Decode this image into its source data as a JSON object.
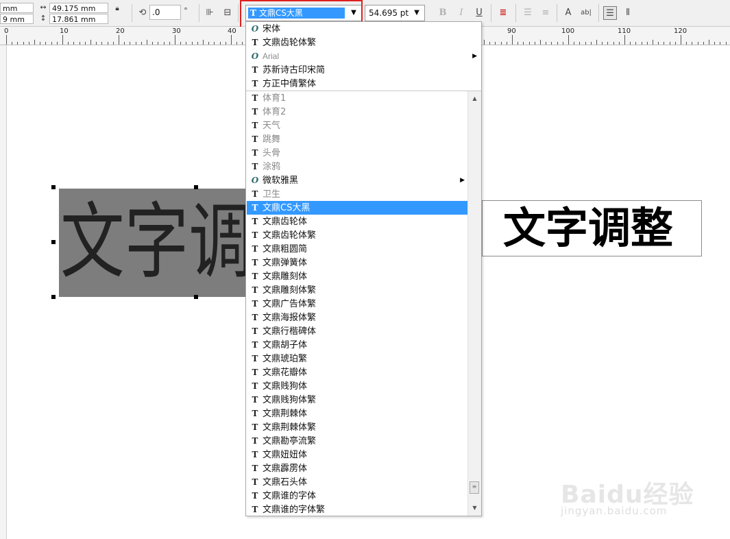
{
  "toolbar": {
    "x_unit": "mm",
    "y_unit": "9 mm",
    "width_value": "49.175 mm",
    "height_value": "17.861 mm",
    "rotation_value": ".0",
    "rotation_unit": "°",
    "font_name": "文鼎CS大黑",
    "font_size": "54.695 pt",
    "bold_label": "B",
    "italic_label": "I",
    "underline_label": "U"
  },
  "ruler": {
    "labels": [
      "0",
      "10",
      "20",
      "30",
      "40",
      "90",
      "100",
      "110",
      "120"
    ]
  },
  "canvas": {
    "gray_text": "文字调",
    "bold_text": "文字调整"
  },
  "dropdown": {
    "recent_fonts": [
      {
        "label": "宋体",
        "type": "opentype"
      },
      {
        "label": "文鼎齿轮体繁",
        "type": "truetype"
      },
      {
        "label": "Arial",
        "type": "opentype"
      },
      {
        "label": "苏新诗古印宋简",
        "type": "truetype"
      },
      {
        "label": "方正中倩繁体",
        "type": "truetype"
      }
    ],
    "fonts": [
      {
        "label": "体育1",
        "type": "truetype"
      },
      {
        "label": "体育2",
        "type": "truetype"
      },
      {
        "label": "天气",
        "type": "truetype"
      },
      {
        "label": "跳舞",
        "type": "truetype"
      },
      {
        "label": "头骨",
        "type": "truetype"
      },
      {
        "label": "涂鸦",
        "type": "truetype"
      },
      {
        "label": "微软雅黑",
        "type": "opentype"
      },
      {
        "label": "卫生",
        "type": "truetype"
      },
      {
        "label": "文鼎CS大黑",
        "type": "truetype"
      },
      {
        "label": "文鼎齿轮体",
        "type": "truetype"
      },
      {
        "label": "文鼎齿轮体繁",
        "type": "truetype"
      },
      {
        "label": "文鼎粗圆简",
        "type": "truetype"
      },
      {
        "label": "文鼎弹簧体",
        "type": "truetype"
      },
      {
        "label": "文鼎雕刻体",
        "type": "truetype"
      },
      {
        "label": "文鼎雕刻体繁",
        "type": "truetype"
      },
      {
        "label": "文鼎广告体繁",
        "type": "truetype"
      },
      {
        "label": "文鼎海报体繁",
        "type": "truetype"
      },
      {
        "label": "文鼎行楷碑体",
        "type": "truetype"
      },
      {
        "label": "文鼎胡子体",
        "type": "truetype"
      },
      {
        "label": "文鼎琥珀繁",
        "type": "truetype"
      },
      {
        "label": "文鼎花瓣体",
        "type": "truetype"
      },
      {
        "label": "文鼎贱狗体",
        "type": "truetype"
      },
      {
        "label": "文鼎贱狗体繁",
        "type": "truetype"
      },
      {
        "label": "文鼎荆棘体",
        "type": "truetype"
      },
      {
        "label": "文鼎荆棘体繁",
        "type": "truetype"
      },
      {
        "label": "文鼎勘亭流繁",
        "type": "truetype"
      },
      {
        "label": "文鼎妞妞体",
        "type": "truetype"
      },
      {
        "label": "文鼎霹雳体",
        "type": "truetype"
      },
      {
        "label": "文鼎石头体",
        "type": "truetype"
      },
      {
        "label": "文鼎谁的字体",
        "type": "truetype"
      },
      {
        "label": "文鼎谁的字体繁",
        "type": "truetype"
      }
    ],
    "selected_font": "文鼎CS大黑"
  },
  "watermark": {
    "main": "Baidu经验",
    "sub": "jingyan.baidu.com"
  },
  "colors": {
    "selection": "#3399ff",
    "highlight_border": "#e02020",
    "toolbar_bg": "#f0f0f0"
  }
}
